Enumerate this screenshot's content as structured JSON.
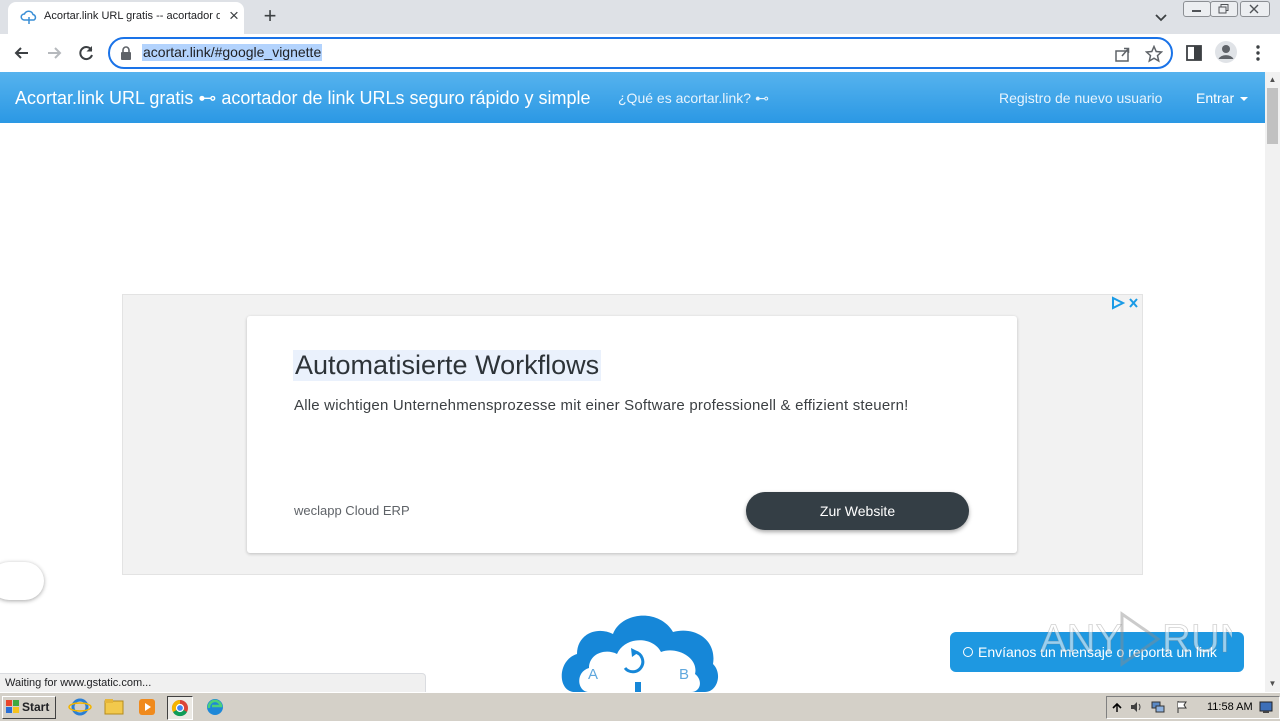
{
  "browser": {
    "tab_title": "Acortar.link URL gratis -- acortador de link URLs seguro rápido y simple",
    "new_tab_icon": "plus-icon",
    "url": "acortar.link/#google_vignette"
  },
  "site_nav": {
    "brand": "Acortar.link URL gratis ⊷ acortador de link URLs seguro rápido y simple",
    "what_is": "¿Qué es acortar.link? ⊷",
    "register": "Registro de nuevo usuario",
    "login": "Entrar"
  },
  "ad": {
    "headline": "Automatisierte Workflows",
    "description": "Alle wichtigen Unternehmensprozesse mit einer Software professionell & effizient steuern!",
    "advertiser": "weclapp Cloud ERP",
    "cta": "Zur Website"
  },
  "chat": {
    "label": "Envíanos un mensaje o reporta un link"
  },
  "status_bar": "Waiting for www.gstatic.com...",
  "watermark": "ANY RUN",
  "taskbar": {
    "start": "Start",
    "clock": "11:58 AM",
    "apps": [
      "internet-explorer-icon",
      "file-explorer-icon",
      "media-player-icon",
      "chrome-icon",
      "edge-icon"
    ]
  },
  "colors": {
    "navbar": "#2b98e4",
    "omnibox_focus": "#1a73e8",
    "cta": "#343e45",
    "chat": "#1e98e1"
  }
}
